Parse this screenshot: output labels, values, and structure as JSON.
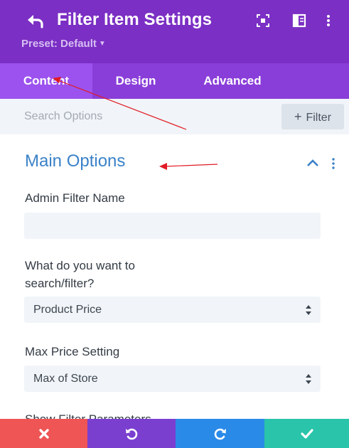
{
  "header": {
    "title": "Filter Item Settings",
    "preset_label": "Preset: Default",
    "icons": [
      "back-arrow-icon",
      "expand-icon",
      "sidebar-toggle-icon",
      "more-vertical-icon"
    ],
    "bg_color": "#7b2fc4"
  },
  "tabs": [
    {
      "label": "Content",
      "active": true
    },
    {
      "label": "Design",
      "active": false
    },
    {
      "label": "Advanced",
      "active": false
    }
  ],
  "search": {
    "placeholder": "Search Options",
    "value": "",
    "filter_button": "Filter"
  },
  "section": {
    "title": "Main Options",
    "accent": "#3b82c8"
  },
  "fields": {
    "admin_filter_name": {
      "label": "Admin Filter Name",
      "value": ""
    },
    "search_filter": {
      "label_line1": "What do you want to",
      "label_line2": "search/filter?",
      "value": "Product Price"
    },
    "max_price": {
      "label": "Max Price Setting",
      "value": "Max of Store"
    },
    "next_label": "Show Filter Parameters"
  },
  "footer": {
    "buttons": [
      {
        "name": "discard",
        "icon": "close-icon",
        "color": "#ef5555"
      },
      {
        "name": "undo",
        "icon": "undo-icon",
        "color": "#7b3fd0"
      },
      {
        "name": "redo",
        "icon": "redo-icon",
        "color": "#2a8ae8"
      },
      {
        "name": "save",
        "icon": "check-icon",
        "color": "#29c4a9"
      }
    ]
  },
  "annotation_color": "#e01b24"
}
